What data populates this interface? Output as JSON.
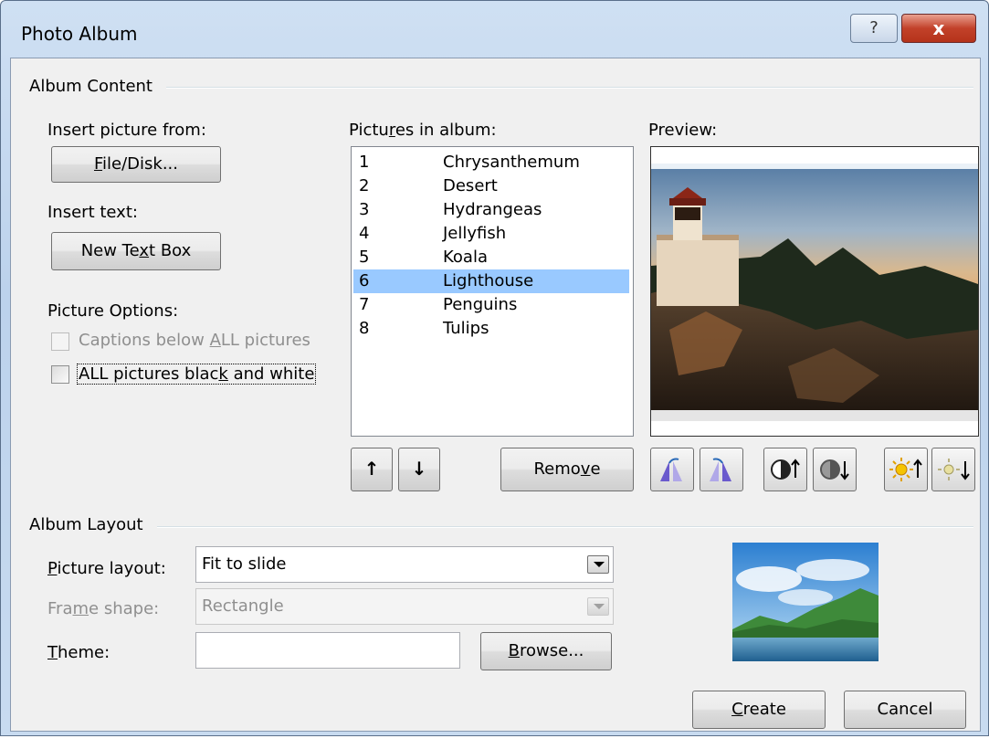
{
  "window": {
    "title": "Photo Album",
    "help_glyph": "?",
    "close_glyph": "x"
  },
  "album_content": {
    "group_label": "Album Content",
    "insert_picture_from_label": "Insert picture from:",
    "file_disk_button": {
      "pre": "",
      "key": "F",
      "post": "ile/Disk..."
    },
    "insert_text_label": "Insert text:",
    "new_text_box_button": {
      "pre": "New Te",
      "key": "x",
      "post": "t Box"
    },
    "picture_options_label": "Picture Options:",
    "captions_checkbox": {
      "pre": "Captions below ",
      "key": "A",
      "post": "LL pictures",
      "checked": false,
      "enabled": false
    },
    "bw_checkbox": {
      "pre": "ALL pictures blac",
      "key": "k",
      "post": " and white",
      "checked": false,
      "enabled": true
    },
    "pictures_in_album_label": {
      "pre": "Pictu",
      "key": "r",
      "post": "es in album:"
    },
    "pictures": [
      {
        "num": "1",
        "name": "Chrysanthemum"
      },
      {
        "num": "2",
        "name": "Desert"
      },
      {
        "num": "3",
        "name": "Hydrangeas"
      },
      {
        "num": "4",
        "name": "Jellyfish"
      },
      {
        "num": "5",
        "name": "Koala"
      },
      {
        "num": "6",
        "name": "Lighthouse"
      },
      {
        "num": "7",
        "name": "Penguins"
      },
      {
        "num": "8",
        "name": "Tulips"
      }
    ],
    "selected_picture": "Lighthouse",
    "move_up_glyph": "↑",
    "move_down_glyph": "↓",
    "remove_button": {
      "pre": "Remo",
      "key": "v",
      "post": "e"
    },
    "preview_label": "Preview:",
    "preview_image": "lighthouse-photo",
    "preview_tools": [
      "rotate-left-icon",
      "rotate-right-icon",
      "contrast-up-icon",
      "contrast-down-icon",
      "brightness-up-icon",
      "brightness-down-icon"
    ]
  },
  "album_layout": {
    "group_label": "Album Layout",
    "picture_layout_label": {
      "pre": "",
      "key": "P",
      "post": "icture layout:"
    },
    "picture_layout_value": "Fit to slide",
    "frame_shape_label": {
      "pre": "Fra",
      "key": "m",
      "post": "e shape:"
    },
    "frame_shape_value": "Rectangle",
    "theme_label": {
      "pre": "",
      "key": "T",
      "post": "heme:"
    },
    "theme_value": "",
    "browse_button": {
      "pre": "",
      "key": "B",
      "post": "rowse..."
    },
    "layout_preview_image": "landscape-thumbnail"
  },
  "footer": {
    "create_button": {
      "pre": "",
      "key": "C",
      "post": "reate"
    },
    "cancel_button": "Cancel"
  },
  "colors": {
    "selection": "#99c9ff",
    "dialog_bg": "#f0f0f0",
    "close_button": "#c2412a"
  }
}
